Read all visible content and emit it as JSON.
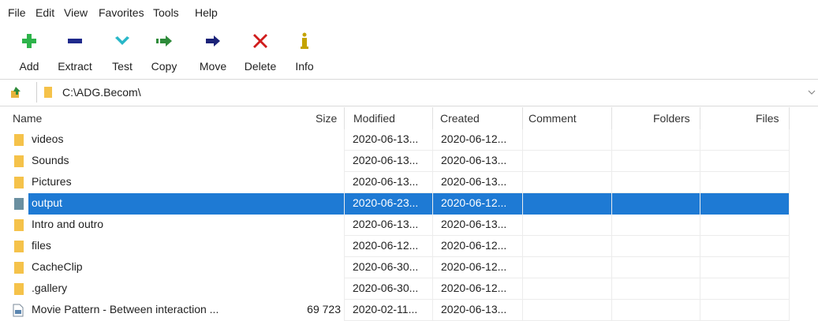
{
  "menu": [
    "File",
    "Edit",
    "View",
    "Favorites",
    "Tools",
    "Help"
  ],
  "toolbar": {
    "add": "Add",
    "extract": "Extract",
    "test": "Test",
    "copy": "Copy",
    "move": "Move",
    "delete": "Delete",
    "info": "Info"
  },
  "address": {
    "path": "C:\\ADG.Becom\\"
  },
  "columns": {
    "name": "Name",
    "size": "Size",
    "modified": "Modified",
    "created": "Created",
    "comment": "Comment",
    "folders": "Folders",
    "files": "Files"
  },
  "rows": [
    {
      "name": "videos",
      "size": "",
      "modified": "2020-06-13...",
      "created": "2020-06-12...",
      "type": "folder"
    },
    {
      "name": "Sounds",
      "size": "",
      "modified": "2020-06-13...",
      "created": "2020-06-13...",
      "type": "folder"
    },
    {
      "name": "Pictures",
      "size": "",
      "modified": "2020-06-13...",
      "created": "2020-06-13...",
      "type": "folder"
    },
    {
      "name": "output",
      "size": "",
      "modified": "2020-06-23...",
      "created": "2020-06-12...",
      "type": "folder",
      "selected": true
    },
    {
      "name": "Intro and outro",
      "size": "",
      "modified": "2020-06-13...",
      "created": "2020-06-13...",
      "type": "folder"
    },
    {
      "name": "files",
      "size": "",
      "modified": "2020-06-12...",
      "created": "2020-06-12...",
      "type": "folder"
    },
    {
      "name": "CacheClip",
      "size": "",
      "modified": "2020-06-30...",
      "created": "2020-06-12...",
      "type": "folder"
    },
    {
      "name": ".gallery",
      "size": "",
      "modified": "2020-06-30...",
      "created": "2020-06-12...",
      "type": "folder"
    },
    {
      "name": "Movie Pattern - Between interaction ...",
      "size": "69 723",
      "modified": "2020-02-11...",
      "created": "2020-06-13...",
      "type": "file"
    }
  ],
  "colors": {
    "add": "#2db34a",
    "extract": "#1f2a8c",
    "test": "#28b7c8",
    "copy": "#2e8b3a",
    "move": "#1b2278",
    "delete": "#d01c1c",
    "info": "#c4a300",
    "folder": "#f5c24a",
    "selection": "#1e7ad4"
  }
}
